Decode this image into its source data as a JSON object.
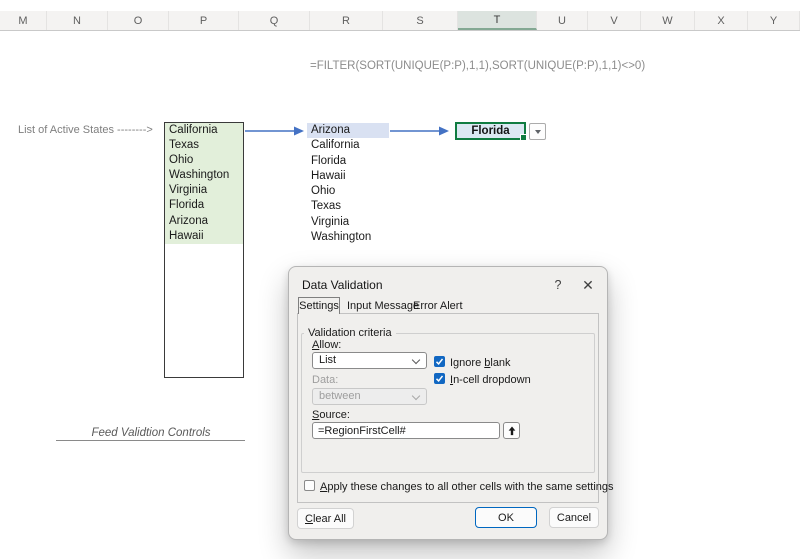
{
  "sheet": {
    "columns": [
      "M",
      "N",
      "O",
      "P",
      "Q",
      "R",
      "S",
      "T",
      "U",
      "V",
      "W",
      "X",
      "Y"
    ],
    "selected_column": "T",
    "formula": "=FILTER(SORT(UNIQUE(P:P),1,1),SORT(UNIQUE(P:P),1,1)<>0)",
    "active_states_label": "List of Active States -------->",
    "source_list": [
      "California",
      "Texas",
      "Ohio",
      "Washington",
      "Virginia",
      "Florida",
      "Arizona",
      "Hawaii"
    ],
    "sorted_list": [
      "Arizona",
      "California",
      "Florida",
      "Hawaii",
      "Ohio",
      "Texas",
      "Virginia",
      "Washington"
    ],
    "sorted_highlighted_item": "Arizona",
    "dropdown_cell_value": "Florida",
    "caption": "Feed Validtion Controls",
    "colors": {
      "selection_green": "#107C41",
      "arrow_blue": "#4472C4",
      "source_fill_green": "#E2EFDA",
      "highlight_blue": "#D9E1F2",
      "dropdown_cell_fill": "#DBE8F2",
      "checkbox_blue": "#1167C2"
    }
  },
  "dialog": {
    "title": "Data Validation",
    "help_glyph": "?",
    "close_glyph": "✕",
    "tabs": [
      "Settings",
      "Input Message",
      "Error Alert"
    ],
    "selected_tab": "Settings",
    "group_label": "Validation criteria",
    "allow": {
      "key": "A",
      "post": "llow:",
      "value": "List"
    },
    "ignore_blank": {
      "pre": "Ignore ",
      "key": "b",
      "post": "lank",
      "checked": true
    },
    "in_cell_dropdown": {
      "key": "I",
      "post": "n-cell dropdown",
      "checked": true
    },
    "data_field": {
      "label": "Data:",
      "value": "between",
      "disabled": true
    },
    "source_field": {
      "key": "S",
      "post": "ource:",
      "value": "=RegionFirstCell#"
    },
    "apply_checkbox": {
      "key": "A",
      "post": "pply these changes to all other cells with the same settings",
      "checked": false
    },
    "buttons": {
      "clear_key": "C",
      "clear_post": "lear All",
      "ok": "OK",
      "cancel": "Cancel"
    }
  }
}
